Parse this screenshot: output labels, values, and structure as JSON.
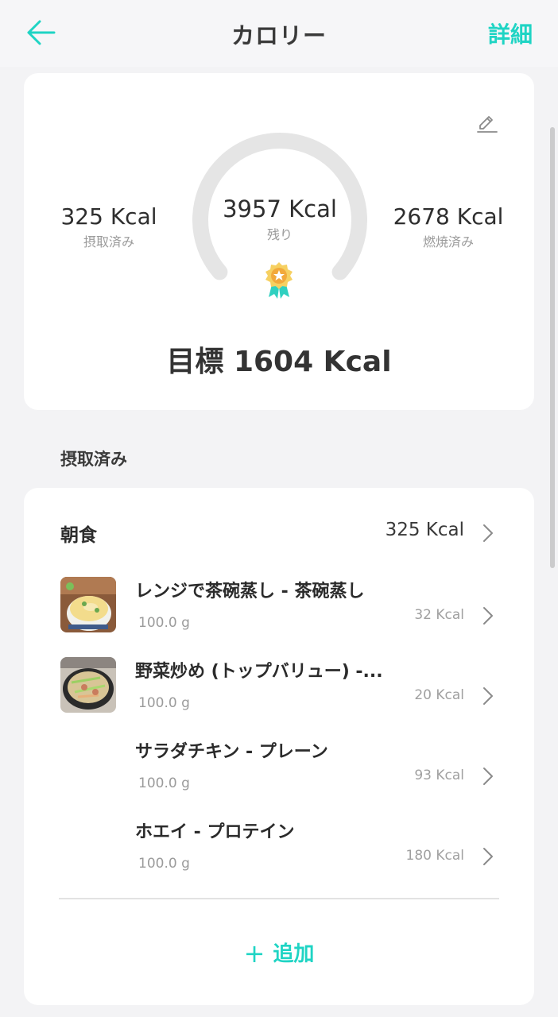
{
  "header": {
    "title": "カロリー",
    "detail_label": "詳細"
  },
  "summary": {
    "intake_value": "325 Kcal",
    "intake_label": "摂取済み",
    "remaining_value": "3957 Kcal",
    "remaining_label": "残り",
    "burned_value": "2678 Kcal",
    "burned_label": "燃焼済み",
    "goal": "目標 1604 Kcal",
    "gauge_fill_fraction": 0.0
  },
  "section_title": "摂取済み",
  "meal": {
    "name": "朝食",
    "kcal": "325 Kcal",
    "items": [
      {
        "name": "レンジで茶碗蒸し - 茶碗蒸し",
        "weight": "100.0 g",
        "kcal": "32 Kcal",
        "thumb": "chawanmushi"
      },
      {
        "name": "野菜炒め (トップバリュー) -...",
        "weight": "100.0 g",
        "kcal": "20 Kcal",
        "thumb": "yasai-itame"
      },
      {
        "name": "サラダチキン - プレーン",
        "weight": "100.0 g",
        "kcal": "93 Kcal",
        "thumb": ""
      },
      {
        "name": "ホエイ - プロテイン",
        "weight": "100.0 g",
        "kcal": "180 Kcal",
        "thumb": ""
      }
    ],
    "add_label": "追加"
  },
  "colors": {
    "accent": "#1fd4c4",
    "background": "#f3f3f5",
    "card": "#ffffff",
    "gauge_track": "#e5e5e5",
    "badge_gold": "#f4c542"
  },
  "icons": {
    "back": "arrow-left-icon",
    "edit": "pencil-icon",
    "badge": "medal-badge-icon",
    "row_chevron": "chevron-right-icon",
    "add": "plus-icon"
  }
}
